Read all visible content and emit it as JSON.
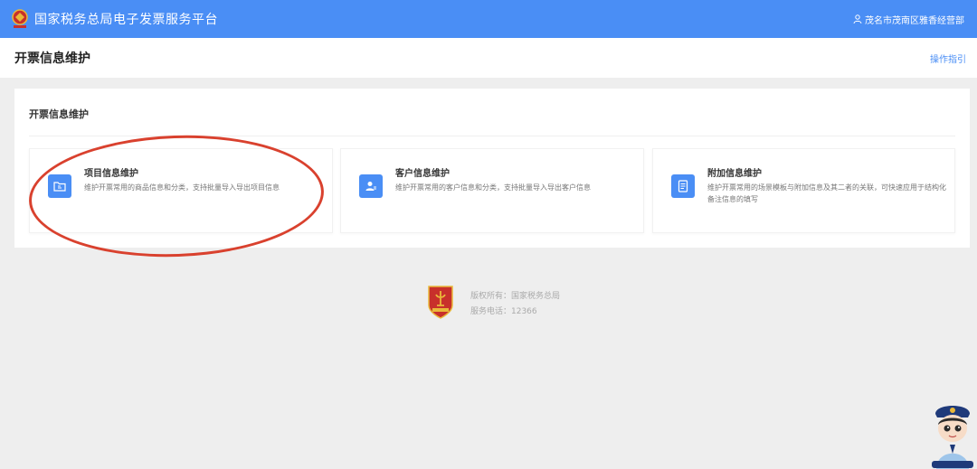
{
  "header": {
    "title": "国家税务总局电子发票服务平台",
    "user": "茂名市茂南区雅香经营部",
    "logo_icon": "tax-emblem-icon",
    "user_icon": "person-icon"
  },
  "page": {
    "title": "开票信息维护",
    "guide_link": "操作指引"
  },
  "panel": {
    "title": "开票信息维护",
    "cards": [
      {
        "icon": "folder-edit-icon",
        "title": "项目信息维护",
        "desc": "维护开票常用的商品信息和分类，支持批量导入导出项目信息"
      },
      {
        "icon": "customer-card-icon",
        "title": "客户信息维护",
        "desc": "维护开票常用的客户信息和分类，支持批量导入导出客户信息"
      },
      {
        "icon": "document-list-icon",
        "title": "附加信息维护",
        "desc": "维护开票常用的场景模板与附加信息及其二者的关联，可快速应用于结构化备注信息的填写"
      }
    ]
  },
  "footer": {
    "copyright": "版权所有：国家税务总局",
    "phone": "服务电话：12366"
  },
  "colors": {
    "primary": "#4a8ef5",
    "annotation": "#d9412e",
    "background": "#eeeeee"
  }
}
